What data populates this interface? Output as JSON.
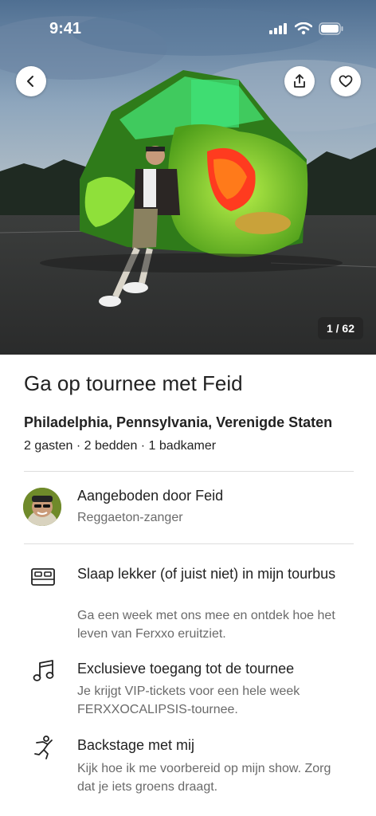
{
  "status_bar": {
    "time": "9:41",
    "icons": [
      "signal-icon",
      "wifi-icon",
      "battery-icon"
    ]
  },
  "hero": {
    "photo_description_icon": "tour-bus-photo",
    "counter": "1 / 62"
  },
  "header_buttons": {
    "back": "chevron-left-icon",
    "share": "share-icon",
    "favorite": "heart-icon"
  },
  "listing": {
    "title": "Ga op tournee met Feid",
    "location": "Philadelphia, Pennsylvania, Verenigde Staten",
    "details": "2 gasten · 2 bedden · 1 badkamer"
  },
  "host": {
    "title": "Aangeboden door Feid",
    "subtitle": "Reggaeton-zanger"
  },
  "features": [
    {
      "icon": "bed-icon",
      "title": "Slaap lekker (of juist niet) in mijn tourbus",
      "description": "Ga een week met ons mee en ontdek hoe het leven van Ferxxo eruitziet."
    },
    {
      "icon": "music-note-icon",
      "title": "Exclusieve toegang tot de tournee",
      "description": "Je krijgt VIP-tickets voor een hele week FERXXOCALIPSIS-tournee."
    },
    {
      "icon": "dancer-icon",
      "title": "Backstage met mij",
      "description": "Kijk hoe ik me voorbereid op mijn show. Zorg dat je iets groens draagt."
    }
  ],
  "colors": {
    "text_primary": "#222222",
    "text_secondary": "#6a6a6a",
    "divider": "#dddddd",
    "bus_green": "#7fd629"
  }
}
